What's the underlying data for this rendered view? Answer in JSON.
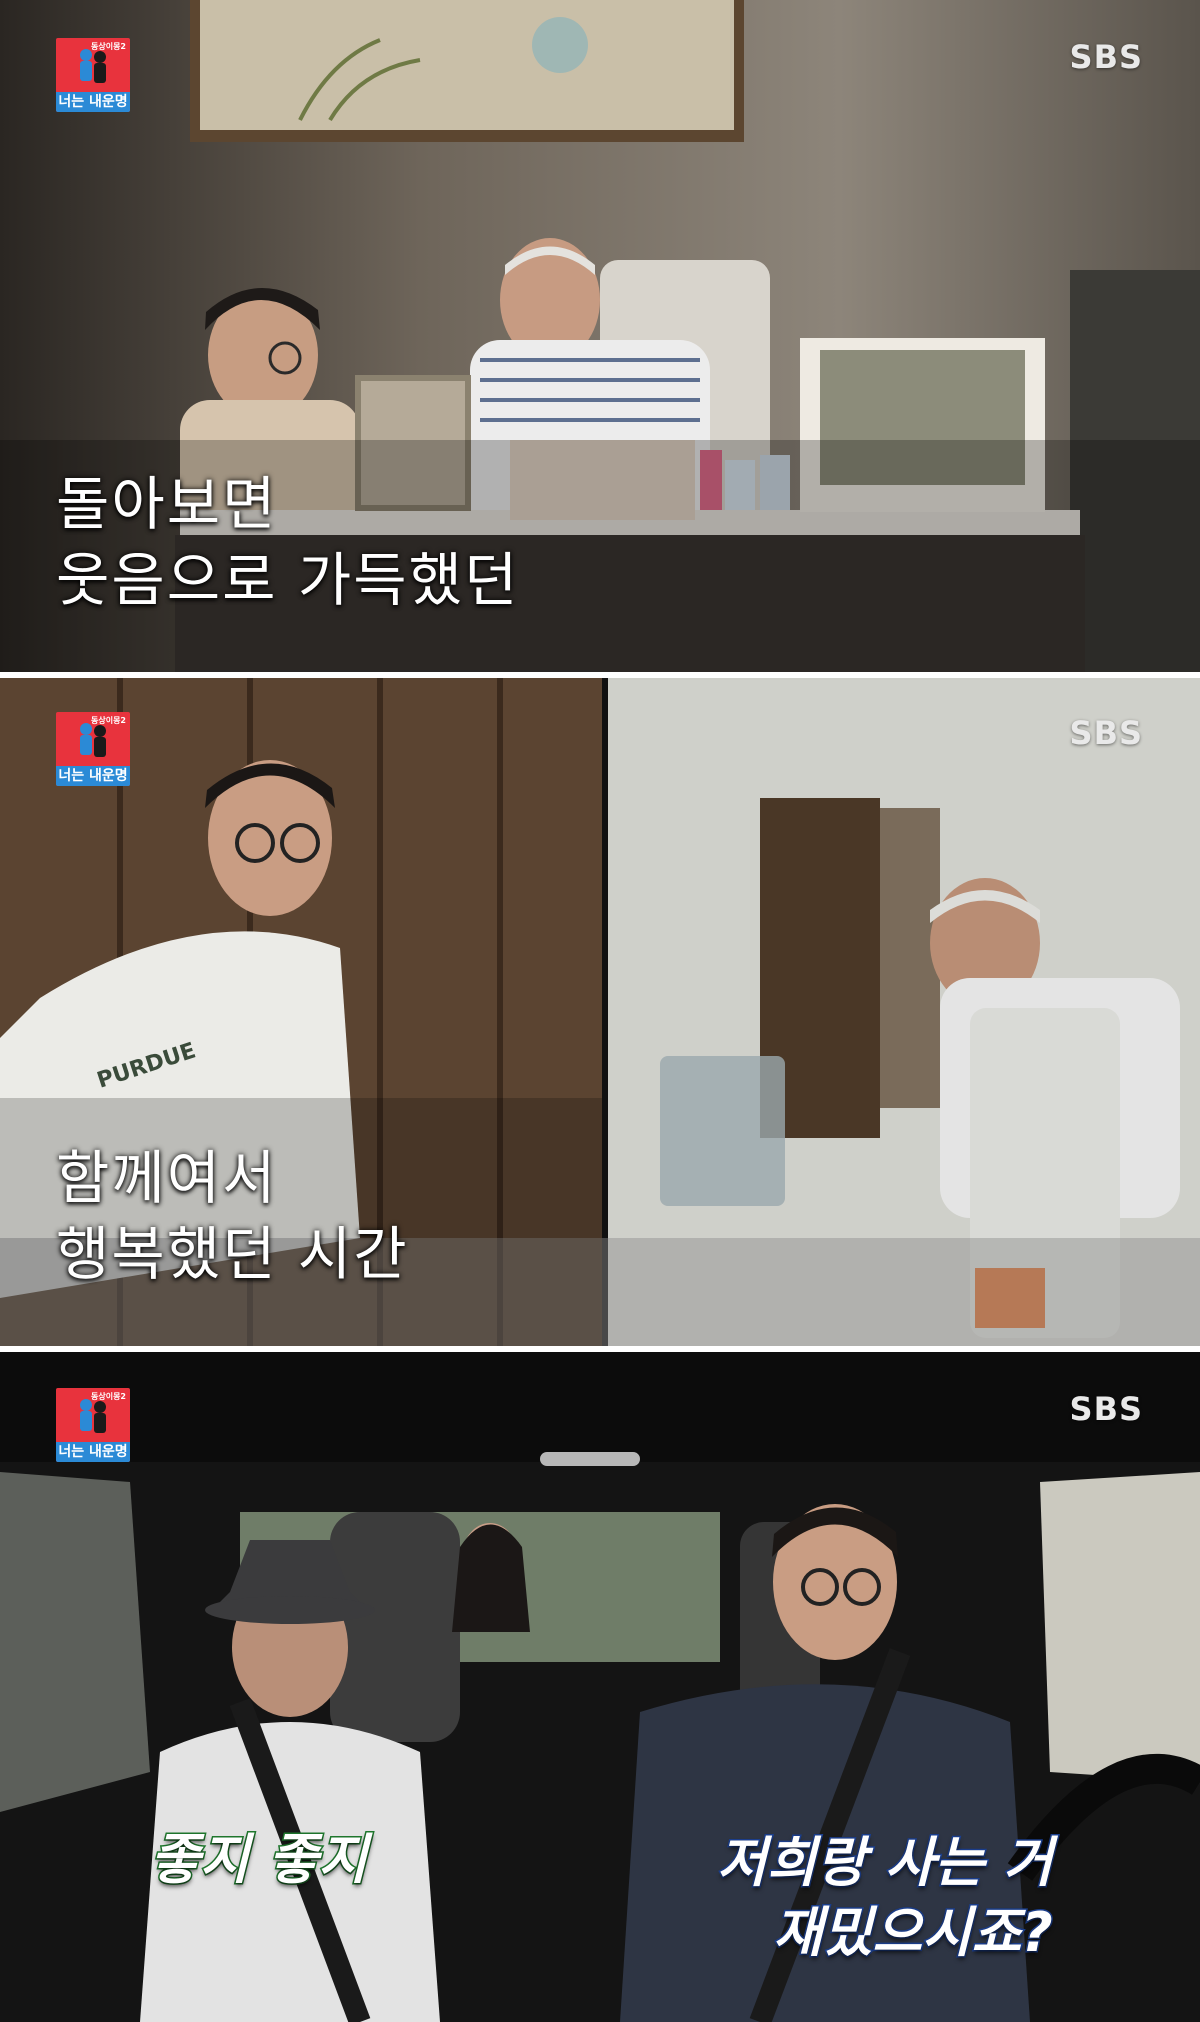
{
  "panels": [
    {
      "program_logo": {
        "small_text": "동상이몽2",
        "title": "너는 내운명"
      },
      "broadcaster": "SBS",
      "caption": [
        "돌아보면",
        "웃음으로 가득했던"
      ]
    },
    {
      "program_logo": {
        "small_text": "동상이몽2",
        "title": "너는 내운명"
      },
      "broadcaster": "SBS",
      "caption": [
        "함께여서",
        "행복했던 시간"
      ]
    },
    {
      "program_logo": {
        "small_text": "동상이몽2",
        "title": "너는 내운명"
      },
      "broadcaster": "SBS",
      "speech_left": "좋지 좋지",
      "speech_right": [
        "저희랑 사는 거",
        "재밌으시죠?"
      ]
    }
  ],
  "colors": {
    "logo_red": "#e8333d",
    "logo_blue": "#2b8ad6",
    "speech_left_outline": "#1f7a2e",
    "speech_right_outline": "#1b3f8f"
  }
}
